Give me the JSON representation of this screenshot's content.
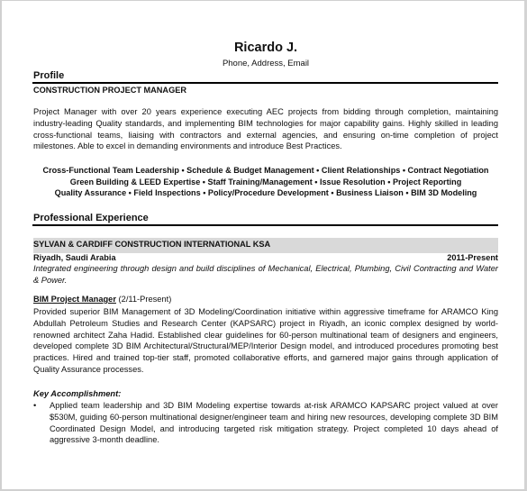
{
  "header": {
    "name": "Ricardo J.",
    "contact": "Phone, Address, Email"
  },
  "profile": {
    "section_title": "Profile",
    "job_title": "CONSTRUCTION PROJECT MANAGER",
    "summary": "Project Manager with over 20 years experience executing AEC projects from bidding through completion, maintaining industry-leading Quality standards, and implementing BIM technologies for major capability gains. Highly skilled in leading cross-functional teams, liaising with contractors and external agencies, and ensuring on-time completion of project milestones. Able to excel in demanding environments and introduce Best Practices.",
    "skills_lines": [
      "Cross-Functional Team Leadership • Schedule & Budget Management • Client Relationships • Contract Negotiation",
      "Green Building & LEED Expertise • Staff Training/Management • Issue Resolution • Project Reporting",
      "Quality Assurance • Field Inspections • Policy/Procedure Development • Business Liaison • BIM 3D Modeling"
    ]
  },
  "experience": {
    "section_title": "Professional Experience",
    "company": {
      "name": "SYLVAN & CARDIFF CONSTRUCTION INTERNATIONAL KSA",
      "location": "Riyadh, Saudi Arabia",
      "dates": "2011-Present",
      "description": "Integrated engineering through design and build disciplines of Mechanical, Electrical, Plumbing, Civil Contracting and Water & Power."
    },
    "role": {
      "title": "BIM Project Manager",
      "period": " (2/11-Present)",
      "description": "Provided superior BIM Management of 3D Modeling/Coordination initiative within aggressive timeframe for ARAMCO King Abdullah Petroleum Studies and Research Center (KAPSARC) project in Riyadh, an iconic complex designed by world-renowned architect Zaha Hadid. Established clear guidelines for 60-person multinational team of designers and engineers, developed complete 3D BIM Architectural/Structural/MEP/Interior Design model, and introduced procedures promoting best practices. Hired and trained top-tier staff, promoted collaborative efforts, and garnered major gains through application of Quality Assurance processes."
    },
    "key_accomplishment": {
      "title": "Key Accomplishment:",
      "bullet": "•",
      "items": [
        "Applied team leadership and 3D BIM Modeling expertise towards at-risk ARAMCO KAPSARC project valued at over $530M, guiding 60-person multinational designer/engineer team and hiring new resources, developing complete 3D BIM Coordinated Design Model, and introducing targeted risk mitigation strategy. Project completed 10 days ahead of aggressive 3-month deadline."
      ]
    }
  }
}
